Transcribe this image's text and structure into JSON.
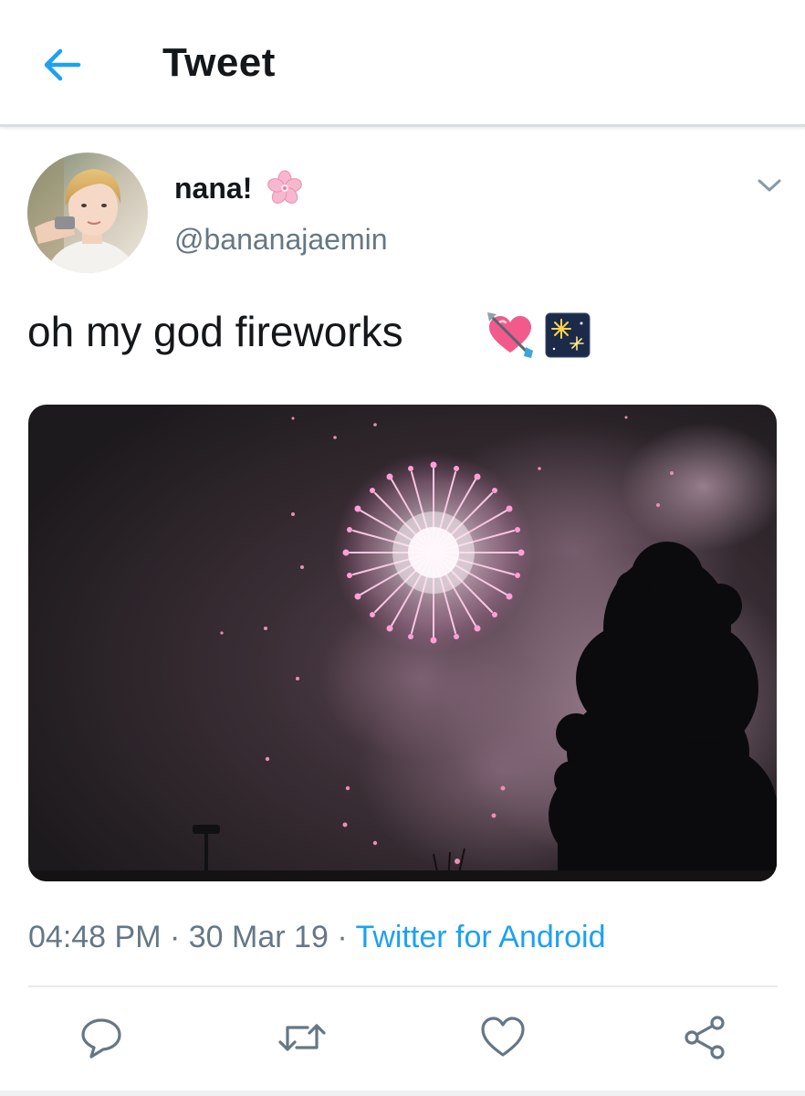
{
  "header": {
    "title": "Tweet",
    "back_icon": "arrow-left-icon"
  },
  "colors": {
    "accent": "#1da1f2",
    "text_primary": "#14171a",
    "text_secondary": "#657786"
  },
  "tweet": {
    "author": {
      "display_name": "nana!",
      "name_emoji": "cherry-blossom-icon",
      "handle": "@bananajaemin"
    },
    "text": "oh my god fireworks",
    "text_emojis": [
      "heart-with-arrow-icon",
      "fireworks-icon"
    ],
    "photo_description_icon": "fireworks-photo",
    "time": "04:48 PM",
    "date": "30 Mar 19",
    "separator": "·",
    "source": "Twitter for Android"
  },
  "actions": [
    {
      "name": "reply",
      "icon": "reply-icon"
    },
    {
      "name": "retweet",
      "icon": "retweet-icon"
    },
    {
      "name": "like",
      "icon": "heart-icon"
    },
    {
      "name": "share",
      "icon": "share-icon"
    }
  ]
}
